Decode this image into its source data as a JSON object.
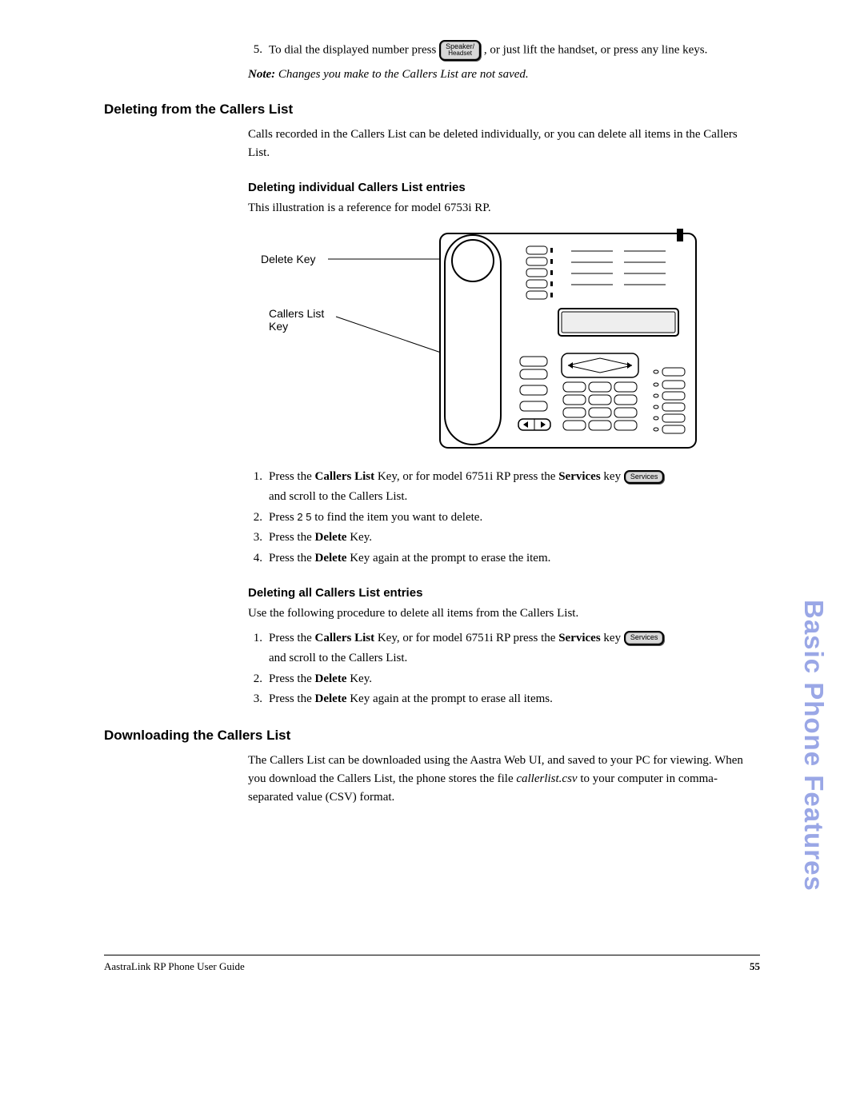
{
  "first_step": {
    "num": "5.",
    "text_before": "To dial the displayed number press ",
    "btn_line1": "Speaker/",
    "btn_line2": "Headset",
    "text_after": ", or just lift the handset, or press any line keys."
  },
  "note_label": "Note:",
  "note_text": " Changes you make to the Callers List are not saved.",
  "h2_deleting": "Deleting from the Callers List",
  "p_deleting": "Calls recorded in the Callers List can be deleted individually, or you can delete all items in the Callers List.",
  "h3_indiv": "Deleting individual Callers List entries",
  "p_indiv": "This illustration is a reference for model 6753i RP.",
  "illus": {
    "label_delete": "Delete Key",
    "label_callers": "Callers List",
    "label_key": "Key"
  },
  "indiv_steps": {
    "s1": {
      "num": "1.",
      "before": "Press the ",
      "bold1": "Callers List",
      "mid": " Key, or for model 6751i RP press the ",
      "bold2": "Services",
      "after": " key",
      "btn": "Services",
      "cont": "and scroll to the Callers List."
    },
    "s2": {
      "num": "2.",
      "before": "Press ",
      "arrows": "2 5",
      "after": " to find the item you want to delete."
    },
    "s3": {
      "num": "3.",
      "before": "Press the ",
      "bold": "Delete",
      "after": " Key."
    },
    "s4": {
      "num": "4.",
      "before": "Press the ",
      "bold": "Delete",
      "after": " Key again at the prompt to erase the item."
    }
  },
  "h3_all": "Deleting all Callers List entries",
  "p_all": "Use the following procedure to delete all items from the Callers List.",
  "all_steps": {
    "s1": {
      "num": "1.",
      "before": "Press the ",
      "bold1": "Callers List",
      "mid": " Key, or for model 6751i RP press the ",
      "bold2": "Services",
      "after": " key",
      "btn": "Services",
      "cont": "and scroll to the Callers List."
    },
    "s2": {
      "num": "2.",
      "before": "Press the ",
      "bold": "Delete",
      "after": " Key."
    },
    "s3": {
      "num": "3.",
      "before": "Press the ",
      "bold": "Delete",
      "after": " Key again at the prompt to erase all items."
    }
  },
  "h2_download": "Downloading the Callers List",
  "p_download_1": "The Callers List can be downloaded using the Aastra Web UI, and saved to your PC for viewing. When you download the Callers List, the phone stores the file ",
  "p_download_file": "callerlist.csv",
  "p_download_2": " to your computer in comma-separated value (CSV) format.",
  "side_title": "Basic Phone Features",
  "footer_left": "AastraLink RP Phone User Guide",
  "footer_right": "55"
}
